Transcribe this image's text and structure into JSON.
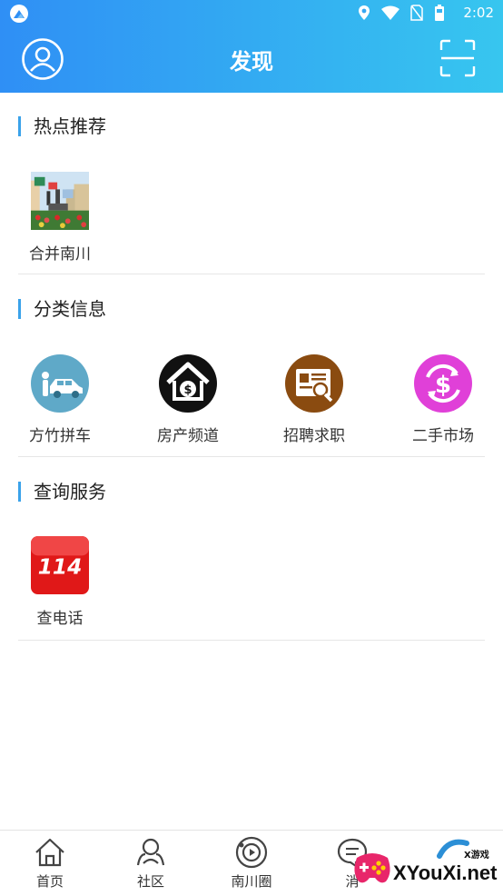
{
  "status_bar": {
    "time": "2:02"
  },
  "header": {
    "title": "发现"
  },
  "sections": [
    {
      "title": "热点推荐",
      "items": [
        {
          "label": "合并南川",
          "icon": "merge-nanchuan-photo"
        }
      ]
    },
    {
      "title": "分类信息",
      "items": [
        {
          "label": "方竹拼车",
          "icon": "carpool-icon"
        },
        {
          "label": "房产频道",
          "icon": "house-dollar-icon"
        },
        {
          "label": "招聘求职",
          "icon": "job-search-icon"
        },
        {
          "label": "二手市场",
          "icon": "secondhand-dollar-icon"
        }
      ]
    },
    {
      "title": "查询服务",
      "items": [
        {
          "label": "查电话",
          "icon": "phone-114-icon"
        }
      ]
    }
  ],
  "bottom_nav": [
    {
      "label": "首页",
      "icon": "home-icon"
    },
    {
      "label": "社区",
      "icon": "community-icon"
    },
    {
      "label": "南川圈",
      "icon": "circle-icon"
    },
    {
      "label": "消",
      "icon": "message-icon"
    }
  ],
  "watermark": {
    "brand": "XYouXi.net",
    "tag": "X游戏"
  },
  "colors": {
    "header_start": "#2f8ff5",
    "header_end": "#37c6ef",
    "section_accent": "#3aa2ea"
  }
}
